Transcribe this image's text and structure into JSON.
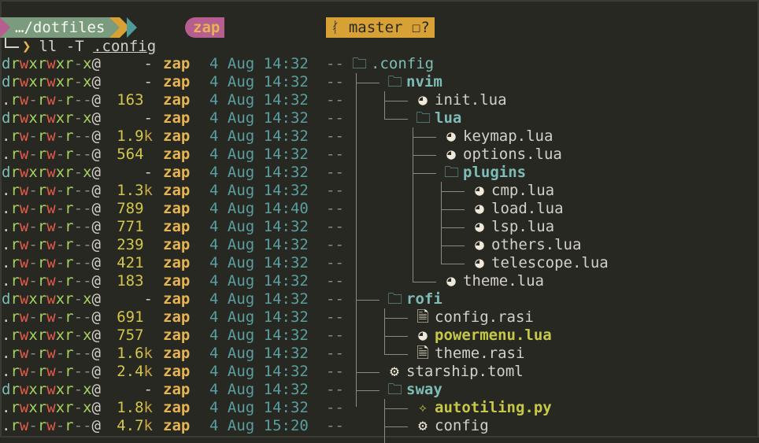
{
  "prompt": {
    "user": "zap",
    "dir": "…/dotfiles",
    "branch": "master",
    "git_status": "?",
    "command": "ll -T",
    "command_arg": ".config"
  },
  "entries": [
    {
      "perm": "drwxrwxr-x@",
      "size": "-",
      "user": "zap",
      "date": "4 Aug 14:32",
      "git": "--",
      "depth": 0,
      "name": ".config",
      "type": "root",
      "icon": "folder-icon"
    },
    {
      "perm": "drwxrwxr-x@",
      "size": "-",
      "user": "zap",
      "date": "4 Aug 14:32",
      "git": "--",
      "depth": 1,
      "name": "nvim",
      "type": "dir",
      "icon": "folder-icon"
    },
    {
      "perm": ".rw-rw-r--@",
      "size": "163",
      "user": "zap",
      "date": "4 Aug 14:32",
      "git": "--",
      "depth": 2,
      "name": "init.lua",
      "type": "file",
      "icon": "lua-icon"
    },
    {
      "perm": "drwxrwxr-x@",
      "size": "-",
      "user": "zap",
      "date": "4 Aug 14:32",
      "git": "--",
      "depth": 2,
      "name": "lua",
      "type": "dir",
      "icon": "folder-icon"
    },
    {
      "perm": ".rw-rw-r--@",
      "size": "1.9k",
      "user": "zap",
      "date": "4 Aug 14:32",
      "git": "--",
      "depth": 3,
      "name": "keymap.lua",
      "type": "file",
      "icon": "lua-icon"
    },
    {
      "perm": ".rw-rw-r--@",
      "size": "564",
      "user": "zap",
      "date": "4 Aug 14:32",
      "git": "--",
      "depth": 3,
      "name": "options.lua",
      "type": "file",
      "icon": "lua-icon"
    },
    {
      "perm": "drwxrwxr-x@",
      "size": "-",
      "user": "zap",
      "date": "4 Aug 14:32",
      "git": "--",
      "depth": 3,
      "name": "plugins",
      "type": "dir",
      "icon": "folder-icon"
    },
    {
      "perm": ".rw-rw-r--@",
      "size": "1.3k",
      "user": "zap",
      "date": "4 Aug 14:32",
      "git": "--",
      "depth": 4,
      "name": "cmp.lua",
      "type": "file",
      "icon": "lua-icon"
    },
    {
      "perm": ".rw-rw-r--@",
      "size": "789",
      "user": "zap",
      "date": "4 Aug 14:40",
      "git": "--",
      "depth": 4,
      "name": "load.lua",
      "type": "file",
      "icon": "lua-icon"
    },
    {
      "perm": ".rw-rw-r--@",
      "size": "771",
      "user": "zap",
      "date": "4 Aug 14:32",
      "git": "--",
      "depth": 4,
      "name": "lsp.lua",
      "type": "file",
      "icon": "lua-icon"
    },
    {
      "perm": ".rw-rw-r--@",
      "size": "239",
      "user": "zap",
      "date": "4 Aug 14:32",
      "git": "--",
      "depth": 4,
      "name": "others.lua",
      "type": "file",
      "icon": "lua-icon"
    },
    {
      "perm": ".rw-rw-r--@",
      "size": "421",
      "user": "zap",
      "date": "4 Aug 14:32",
      "git": "--",
      "depth": 4,
      "name": "telescope.lua",
      "type": "file",
      "icon": "lua-icon"
    },
    {
      "perm": ".rw-rw-r--@",
      "size": "183",
      "user": "zap",
      "date": "4 Aug 14:32",
      "git": "--",
      "depth": 3,
      "name": "theme.lua",
      "type": "file",
      "icon": "lua-icon"
    },
    {
      "perm": "drwxrwxr-x@",
      "size": "-",
      "user": "zap",
      "date": "4 Aug 14:32",
      "git": "--",
      "depth": 1,
      "name": "rofi",
      "type": "dir",
      "icon": "folder-icon"
    },
    {
      "perm": ".rw-rw-r--@",
      "size": "691",
      "user": "zap",
      "date": "4 Aug 14:32",
      "git": "--",
      "depth": 2,
      "name": "config.rasi",
      "type": "file",
      "icon": "file-icon"
    },
    {
      "perm": ".rwxrwxr-x@",
      "size": "757",
      "user": "zap",
      "date": "4 Aug 14:32",
      "git": "--",
      "depth": 2,
      "name": "powermenu.lua",
      "type": "exec",
      "icon": "lua-icon"
    },
    {
      "perm": ".rw-rw-r--@",
      "size": "1.6k",
      "user": "zap",
      "date": "4 Aug 14:32",
      "git": "--",
      "depth": 2,
      "name": "theme.rasi",
      "type": "file",
      "icon": "file-icon"
    },
    {
      "perm": ".rw-rw-r--@",
      "size": "2.4k",
      "user": "zap",
      "date": "4 Aug 14:32",
      "git": "--",
      "depth": 1,
      "name": "starship.toml",
      "type": "file",
      "icon": "gear-icon"
    },
    {
      "perm": "drwxrwxr-x@",
      "size": "-",
      "user": "zap",
      "date": "4 Aug 14:32",
      "git": "--",
      "depth": 1,
      "name": "sway",
      "type": "dir",
      "icon": "folder-icon"
    },
    {
      "perm": ".rwxrwxr-x@",
      "size": "1.8k",
      "user": "zap",
      "date": "4 Aug 14:32",
      "git": "--",
      "depth": 2,
      "name": "autotiling.py",
      "type": "exec",
      "icon": "python-icon"
    },
    {
      "perm": ".rw-rw-r--@",
      "size": "4.7k",
      "user": "zap",
      "date": "4 Aug 15:20",
      "git": "--",
      "depth": 2,
      "name": "config",
      "type": "file",
      "icon": "config-icon"
    }
  ]
}
